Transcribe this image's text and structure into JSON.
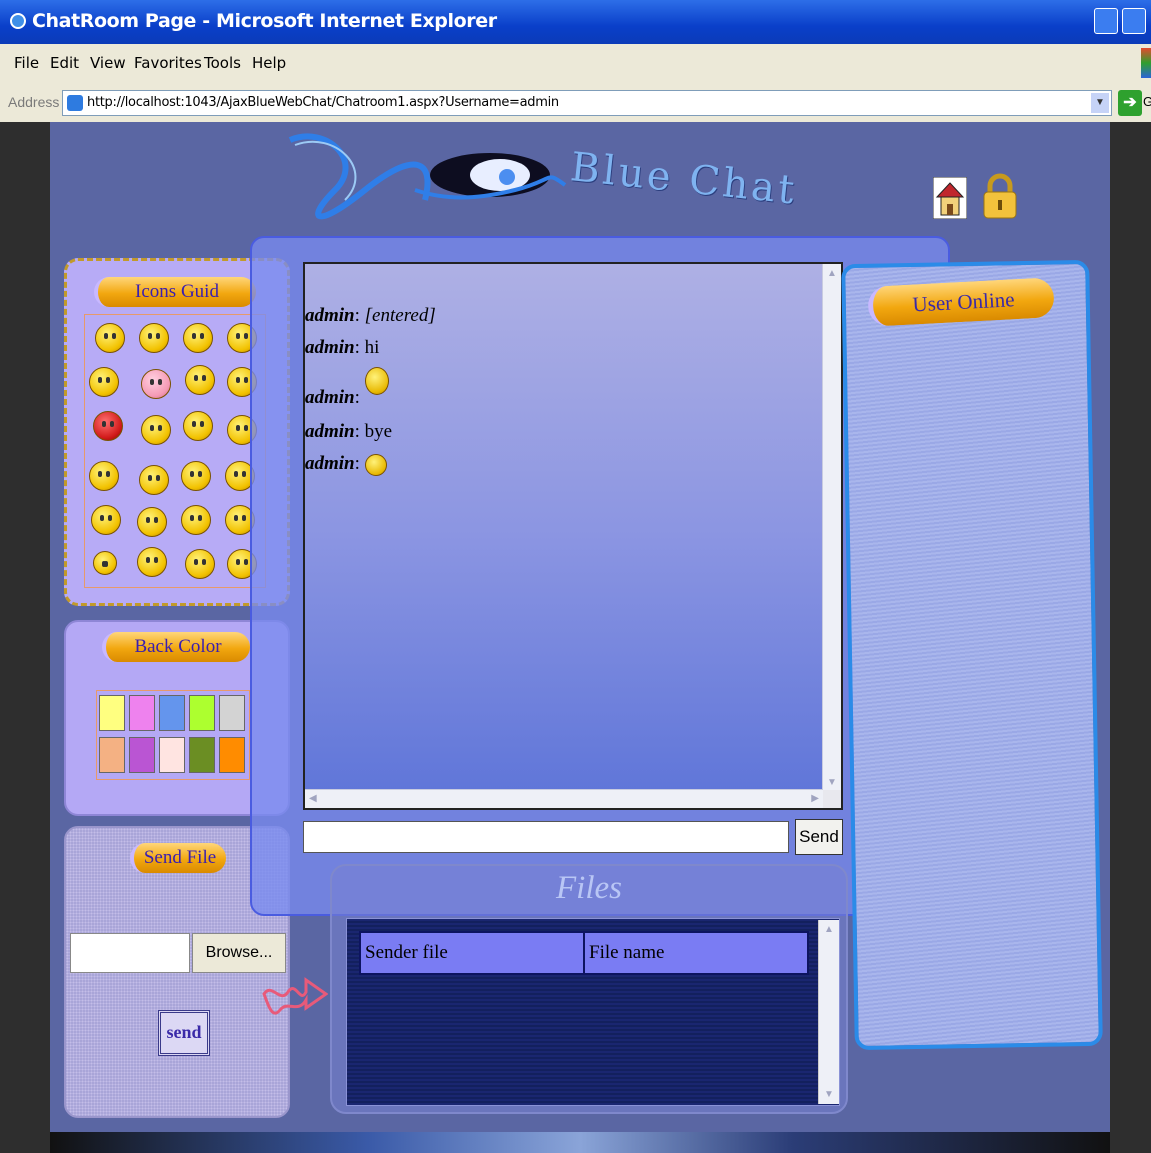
{
  "window": {
    "title": "ChatRoom Page - Microsoft Internet Explorer"
  },
  "menu": {
    "items": [
      "File",
      "Edit",
      "View",
      "Favorites",
      "Tools",
      "Help"
    ]
  },
  "address": {
    "label": "Address",
    "url": "http://localhost:1043/AjaxBlueWebChat/Chatroom1.aspx?Username=admin",
    "go_label": "G"
  },
  "logo": {
    "text": "Blue Chat"
  },
  "icons_panel": {
    "title": "Icons Guid",
    "icons": [
      "smiley-icon",
      "smiley-icon",
      "smiley-icon",
      "smiley-icon",
      "smiley-icon",
      "smiley-icon",
      "smiley-icon",
      "smiley-icon",
      "angry-smiley-icon",
      "smiley-icon",
      "smiley-icon",
      "smiley-icon",
      "smiley-icon",
      "smiley-icon",
      "smiley-icon",
      "smiley-icon",
      "smiley-icon",
      "smiley-icon",
      "smiley-icon",
      "smiley-icon",
      "smiley-icon",
      "smiley-icon",
      "smiley-icon",
      "smiley-icon"
    ]
  },
  "back_color": {
    "title": "Back Color",
    "colors": [
      "#ffff80",
      "#ee82ee",
      "#6495ed",
      "#adff2f",
      "#d3d3d3",
      "#f4b183",
      "#ba55d3",
      "#ffe4e1",
      "#6b8e23",
      "#ff8c00"
    ]
  },
  "send_file": {
    "title": "Send File",
    "browse_label": "Browse...",
    "send_label": "send"
  },
  "chat": {
    "messages": [
      {
        "user": "admin",
        "sep": ": ",
        "text": "[entered]",
        "italic": true,
        "emoticon": false
      },
      {
        "user": "admin",
        "sep": ": ",
        "text": "hi",
        "italic": false,
        "emoticon": false
      },
      {
        "user": "admin",
        "sep": ": ",
        "text": "",
        "italic": false,
        "emoticon": true
      },
      {
        "user": "admin",
        "sep": ": ",
        "text": "bye",
        "italic": false,
        "emoticon": false
      },
      {
        "user": "admin",
        "sep": ": ",
        "text": "",
        "italic": false,
        "emoticon": true
      }
    ],
    "send_label": "Send",
    "input_value": ""
  },
  "files": {
    "title": "Files",
    "columns": [
      "Sender file",
      "File name"
    ]
  },
  "users": {
    "title": "User Online"
  }
}
